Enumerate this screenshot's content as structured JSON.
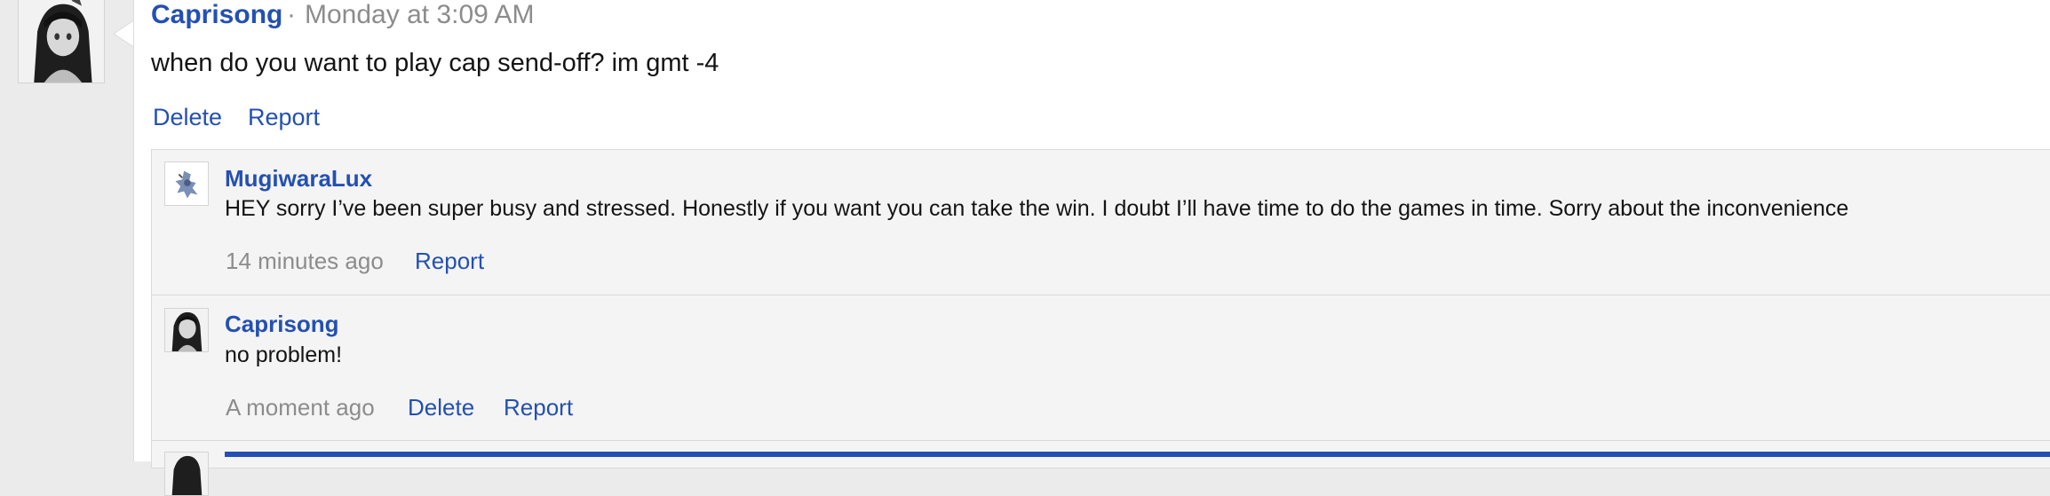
{
  "post": {
    "username": "Caprisong",
    "separator": "·",
    "timestamp": "Monday at 3:09 AM",
    "body": "when do you want to play cap send-off? im gmt -4",
    "delete_label": "Delete",
    "report_label": "Report"
  },
  "comments": [
    {
      "username": "MugiwaraLux",
      "body": "HEY sorry I’ve been super busy and stressed. Honestly if you want you can take the win. I doubt I’ll have time to do the games in time. Sorry about the inconvenience",
      "timestamp": "14 minutes ago",
      "report_label": "Report"
    },
    {
      "username": "Caprisong",
      "body": "no problem!",
      "timestamp": "A moment ago",
      "delete_label": "Delete",
      "report_label": "Report"
    }
  ],
  "colors": {
    "link": "#2450b2",
    "muted": "#8c8c8c",
    "page_bg": "#ebebeb",
    "comment_bg": "#f4f4f4",
    "reply_bar": "#2450b2"
  },
  "icons": {
    "main_avatar": "avatar-anime-girl-icon",
    "commenter_avatar": "avatar-mech-icon",
    "pointer": "speech-pointer-icon"
  }
}
